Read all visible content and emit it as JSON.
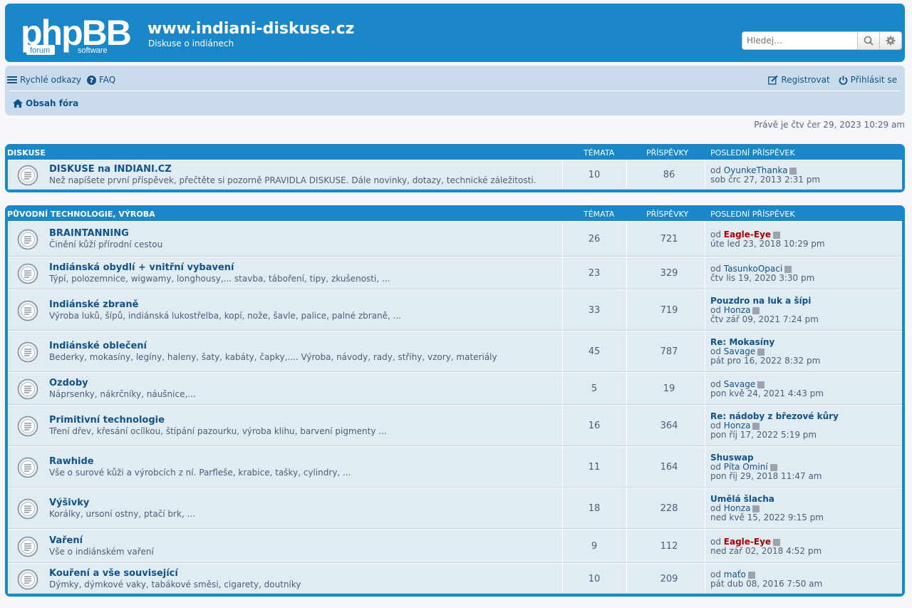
{
  "site": {
    "title": "www.indiani-diskuse.cz",
    "description": "Diskuse o indiánech",
    "search_placeholder": "Hledej…",
    "logo_text": "phpBB",
    "logo_sub1": "forum",
    "logo_sub2": "software"
  },
  "nav": {
    "quick_links": "Rychlé odkazy",
    "faq": "FAQ",
    "register": "Registrovat",
    "login": "Přihlásit se",
    "breadcrumb": "Obsah fóra"
  },
  "datetime": "Právě je čtv čer 29, 2023 10:29 am",
  "categories": [
    {
      "name": "DISKUSE",
      "col_topics": "TÉMATA",
      "col_posts": "PŘÍSPĚVKY",
      "col_last": "POSLEDNÍ PŘÍSPĚVEK",
      "forums": [
        {
          "title": "DISKUSE na INDIANI.CZ",
          "desc": "Než napíšete první příspěvek, přečtěte si pozorně PRAVIDLA DISKUSE. Dále novinky, dotazy, technické záležitosti.",
          "topics": "10",
          "posts": "86",
          "last_title": "",
          "last_by_prefix": "od",
          "last_by": "OyunkeThanka",
          "last_by_red": false,
          "last_date": "sob črc 27, 2013 2:31 pm"
        }
      ]
    },
    {
      "name": "PŮVODNÍ TECHNOLOGIE, VÝROBA",
      "col_topics": "TÉMATA",
      "col_posts": "PŘÍSPĚVKY",
      "col_last": "POSLEDNÍ PŘÍSPĚVEK",
      "forums": [
        {
          "title": "BRAINTANNING",
          "desc": "Činění kůží přírodní cestou",
          "topics": "26",
          "posts": "721",
          "last_title": "",
          "last_by_prefix": "od",
          "last_by": "Eagle-Eye",
          "last_by_red": true,
          "last_date": "úte led 23, 2018 10:29 pm"
        },
        {
          "title": "Indiánská obydlí + vnitřní vybavení",
          "desc": "Týpí, polozemnice, wigwamy, longhousy,... stavba, táboření, tipy, zkušenosti, ...",
          "topics": "23",
          "posts": "329",
          "last_title": "",
          "last_by_prefix": "od",
          "last_by": "TasunkoOpaci",
          "last_by_red": false,
          "last_date": "čtv lis 19, 2020 3:30 pm"
        },
        {
          "title": "Indiánské zbraně",
          "desc": "Výroba luků, šípů, indiánská lukostřelba, kopí, nože, šavle, palice, palné zbraně, ...",
          "topics": "33",
          "posts": "719",
          "last_title": "Pouzdro na luk a šípi",
          "last_by_prefix": "od",
          "last_by": "Honza",
          "last_by_red": false,
          "last_date": "čtv zář 09, 2021 7:24 pm"
        },
        {
          "title": "Indiánské oblečení",
          "desc": "Bederky, mokasíny, legíny, haleny, šaty, kabáty, čapky,.... Výroba, návody, rady, střihy, vzory, materiály",
          "topics": "45",
          "posts": "787",
          "last_title": "Re: Mokasíny",
          "last_by_prefix": "od",
          "last_by": "Savage",
          "last_by_red": false,
          "last_date": "pát pro 16, 2022 8:32 pm"
        },
        {
          "title": "Ozdoby",
          "desc": "Náprsenky, nákrčníky, náušnice,...",
          "topics": "5",
          "posts": "19",
          "last_title": "",
          "last_by_prefix": "od",
          "last_by": "Savage",
          "last_by_red": false,
          "last_date": "pon kvě 24, 2021 4:43 pm"
        },
        {
          "title": "Primitivní technologie",
          "desc": "Tření dřev, křesání ocílkou, štípání pazourku, výroba klihu, barvení pigmenty ...",
          "topics": "16",
          "posts": "364",
          "last_title": "Re: nádoby z březové kůry",
          "last_by_prefix": "od",
          "last_by": "Honza",
          "last_by_red": false,
          "last_date": "pon říj 17, 2022 5:19 pm"
        },
        {
          "title": "Rawhide",
          "desc": "Vše o surové kůži a výrobcích z ní. Parfleše, krabice, tašky, cylindry, ...",
          "topics": "11",
          "posts": "164",
          "last_title": "Shuswap",
          "last_by_prefix": "od",
          "last_by": "Píta Ominí",
          "last_by_red": false,
          "last_date": "pon říj 29, 2018 11:47 am"
        },
        {
          "title": "Výšivky",
          "desc": "Korálky, ursoní ostny, ptačí brk, ...",
          "topics": "18",
          "posts": "228",
          "last_title": "Umělá šlacha",
          "last_by_prefix": "od",
          "last_by": "Honza",
          "last_by_red": false,
          "last_date": "ned kvě 15, 2022 9:15 pm"
        },
        {
          "title": "Vaření",
          "desc": "Vše o indiánském vaření",
          "topics": "9",
          "posts": "112",
          "last_title": "",
          "last_by_prefix": "od",
          "last_by": "Eagle-Eye",
          "last_by_red": true,
          "last_date": "ned zář 02, 2018 4:52 pm"
        },
        {
          "title": "Kouření a vše související",
          "desc": "Dýmky, dýmkové vaky, tabákové směsi, cigarety, doutníky",
          "topics": "10",
          "posts": "209",
          "last_title": "",
          "last_by_prefix": "od",
          "last_by": "maťo",
          "last_by_red": false,
          "last_date": "pát dub 08, 2016 7:50 am"
        }
      ]
    }
  ],
  "colors": {
    "header_blue": "#1a87c9",
    "nav_bg": "#cadceb",
    "row_bg": "#e1ebf2",
    "link": "#105289",
    "admin_red": "#aa0000"
  }
}
